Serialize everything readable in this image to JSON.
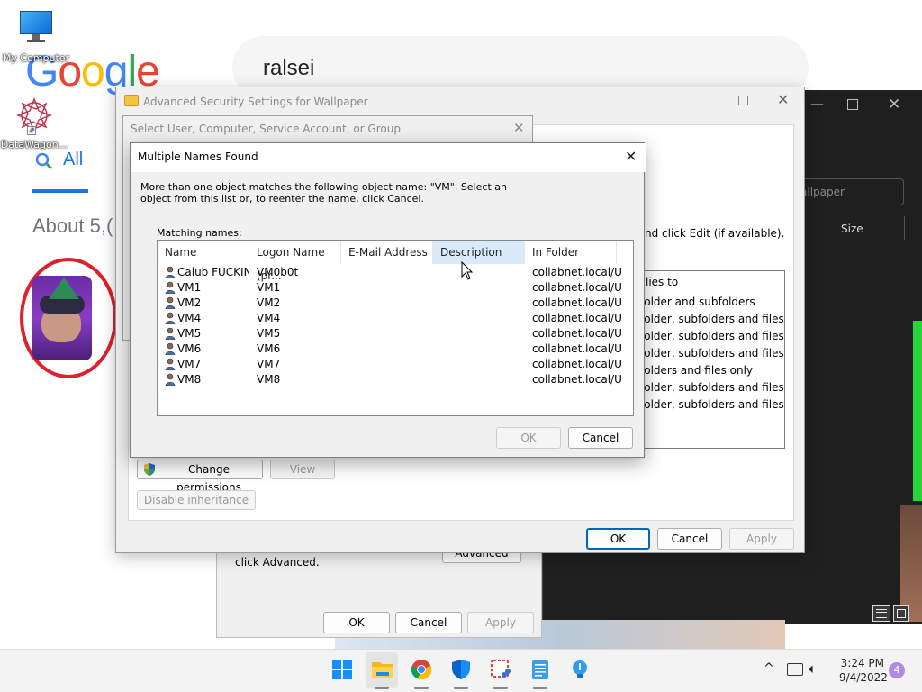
{
  "desktop": {
    "icons": [
      {
        "label": "My Computer"
      },
      {
        "label": "DataWagon..."
      }
    ]
  },
  "browser": {
    "logo_text": "Google",
    "search_query": "ralsei",
    "tab_all": "All",
    "about_text": "About 5,("
  },
  "dark_window": {
    "search_placeholder": "allpaper",
    "size_header": "Size"
  },
  "properties_dialog": {
    "text": "click Advanced.",
    "advanced_button": "Advanced",
    "ok": "OK",
    "cancel": "Cancel",
    "apply": "Apply"
  },
  "advanced_security": {
    "title": "Advanced Security Settings for Wallpaper",
    "hint_text": "nd click Edit (if available).",
    "applies_to": [
      "lies to",
      "folder and subfolders",
      "folder, subfolders and files",
      "folder, subfolders and files",
      "folder, subfolders and files",
      "folders and files only",
      "folder, subfolders and files",
      "folder, subfolders and files"
    ],
    "change_permissions": "Change permissions",
    "view": "View",
    "disable_inheritance": "Disable inheritance",
    "ok": "OK",
    "cancel": "Cancel",
    "apply": "Apply"
  },
  "select_user": {
    "title": "Select User, Computer, Service Account, or Group"
  },
  "multiple_names": {
    "title": "Multiple Names Found",
    "message_line1": "More than one object matches the following object name: \"VM\". Select an",
    "message_line2": "object from this list or, to reenter the name, click Cancel.",
    "list_label": "Matching names:",
    "columns": [
      "Name",
      "Logon Name (pr...",
      "E-Mail Address",
      "Description",
      "In Folder"
    ],
    "rows": [
      {
        "name": "Calub FUCKIN...",
        "logon": "VM0b0t",
        "email": "",
        "description": "",
        "folder": "collabnet.local/U..."
      },
      {
        "name": "VM1",
        "logon": "VM1",
        "email": "",
        "description": "",
        "folder": "collabnet.local/U..."
      },
      {
        "name": "VM2",
        "logon": "VM2",
        "email": "",
        "description": "",
        "folder": "collabnet.local/U..."
      },
      {
        "name": "VM4",
        "logon": "VM4",
        "email": "",
        "description": "",
        "folder": "collabnet.local/U..."
      },
      {
        "name": "VM5",
        "logon": "VM5",
        "email": "",
        "description": "",
        "folder": "collabnet.local/U..."
      },
      {
        "name": "VM6",
        "logon": "VM6",
        "email": "",
        "description": "",
        "folder": "collabnet.local/U..."
      },
      {
        "name": "VM7",
        "logon": "VM7",
        "email": "",
        "description": "",
        "folder": "collabnet.local/U..."
      },
      {
        "name": "VM8",
        "logon": "VM8",
        "email": "",
        "description": "",
        "folder": "collabnet.local/U..."
      }
    ],
    "ok": "OK",
    "cancel": "Cancel"
  },
  "taskbar": {
    "apps": [
      "start-icon",
      "file-explorer-icon",
      "chrome-icon",
      "defender-icon",
      "snipping-tool-icon",
      "notepad-icon",
      "tips-icon"
    ],
    "time": "3:24 PM",
    "date": "9/4/2022",
    "notification_count": "4"
  },
  "colors": {
    "accent": "#0067c0",
    "google_blue": "#4285f4",
    "google_red": "#ea4335",
    "google_yellow": "#fbbc05",
    "google_green": "#34a853",
    "red_circle": "#e0202a"
  }
}
